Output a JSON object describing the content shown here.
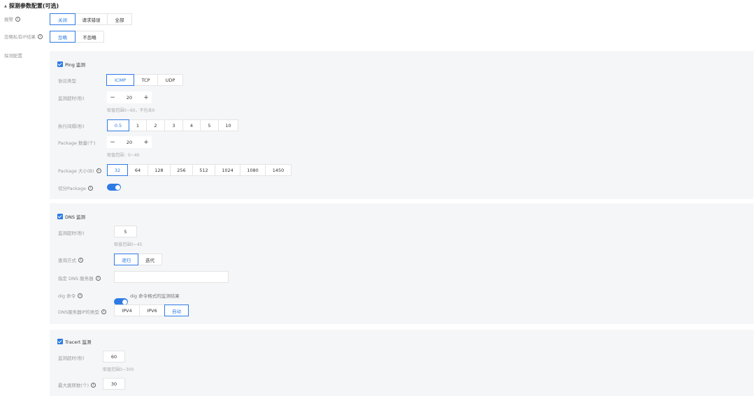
{
  "section": {
    "title": "探测参数配置(可选)"
  },
  "alarm": {
    "label": "报警",
    "options": [
      "关闭",
      "请求错误",
      "全部"
    ],
    "selected": 0
  },
  "private_ip": {
    "label": "忽略私有IP结果",
    "options": [
      "忽略",
      "不忽略"
    ],
    "selected": 0
  },
  "probe_config": {
    "label": "探测配置"
  },
  "ping": {
    "title": "Ping 监测",
    "protocol": {
      "label": "协议类型",
      "options": [
        "ICMP",
        "TCP",
        "UDP"
      ],
      "selected": 0
    },
    "timeout": {
      "label": "监测超时(秒)",
      "minus": "−",
      "value": "20",
      "plus": "+",
      "hint": "取值范围0~60，不包含0"
    },
    "interval": {
      "label": "执行间隔(秒)",
      "options": [
        "0.5",
        "1",
        "2",
        "3",
        "4",
        "5",
        "10"
      ],
      "selected": 0
    },
    "pkg_count": {
      "label": "Package 数量(个)",
      "minus": "−",
      "value": "20",
      "plus": "+",
      "hint": "取值范围：0~40"
    },
    "pkg_size": {
      "label": "Package 大小(B)",
      "options": [
        "32",
        "64",
        "128",
        "256",
        "512",
        "1024",
        "1080",
        "1450"
      ],
      "selected": 0
    },
    "split": {
      "label": "切分Package"
    }
  },
  "dns": {
    "title": "DNS 监测",
    "timeout": {
      "label": "监测超时(秒)",
      "value": "5",
      "hint": "取值范围0~45"
    },
    "query": {
      "label": "查询方式",
      "options": [
        "递归",
        "迭代"
      ],
      "selected": 0
    },
    "server": {
      "label": "指定 DNS 服务器",
      "value": "",
      "placeholder": ""
    },
    "dig": {
      "label": "dig 命令",
      "toggle_text": "dig 命令格式的监测结果"
    },
    "ip_type": {
      "label": "DNS服务器IP的类型",
      "options": [
        "IPV4",
        "IPV6",
        "自动"
      ],
      "selected": 2
    }
  },
  "tracert": {
    "title": "Tracert 监测",
    "timeout": {
      "label": "监测超时(秒)",
      "value": "60",
      "hint": "取值范围0~300"
    },
    "hops": {
      "label": "最大跳转数(个)",
      "value": "30"
    }
  }
}
